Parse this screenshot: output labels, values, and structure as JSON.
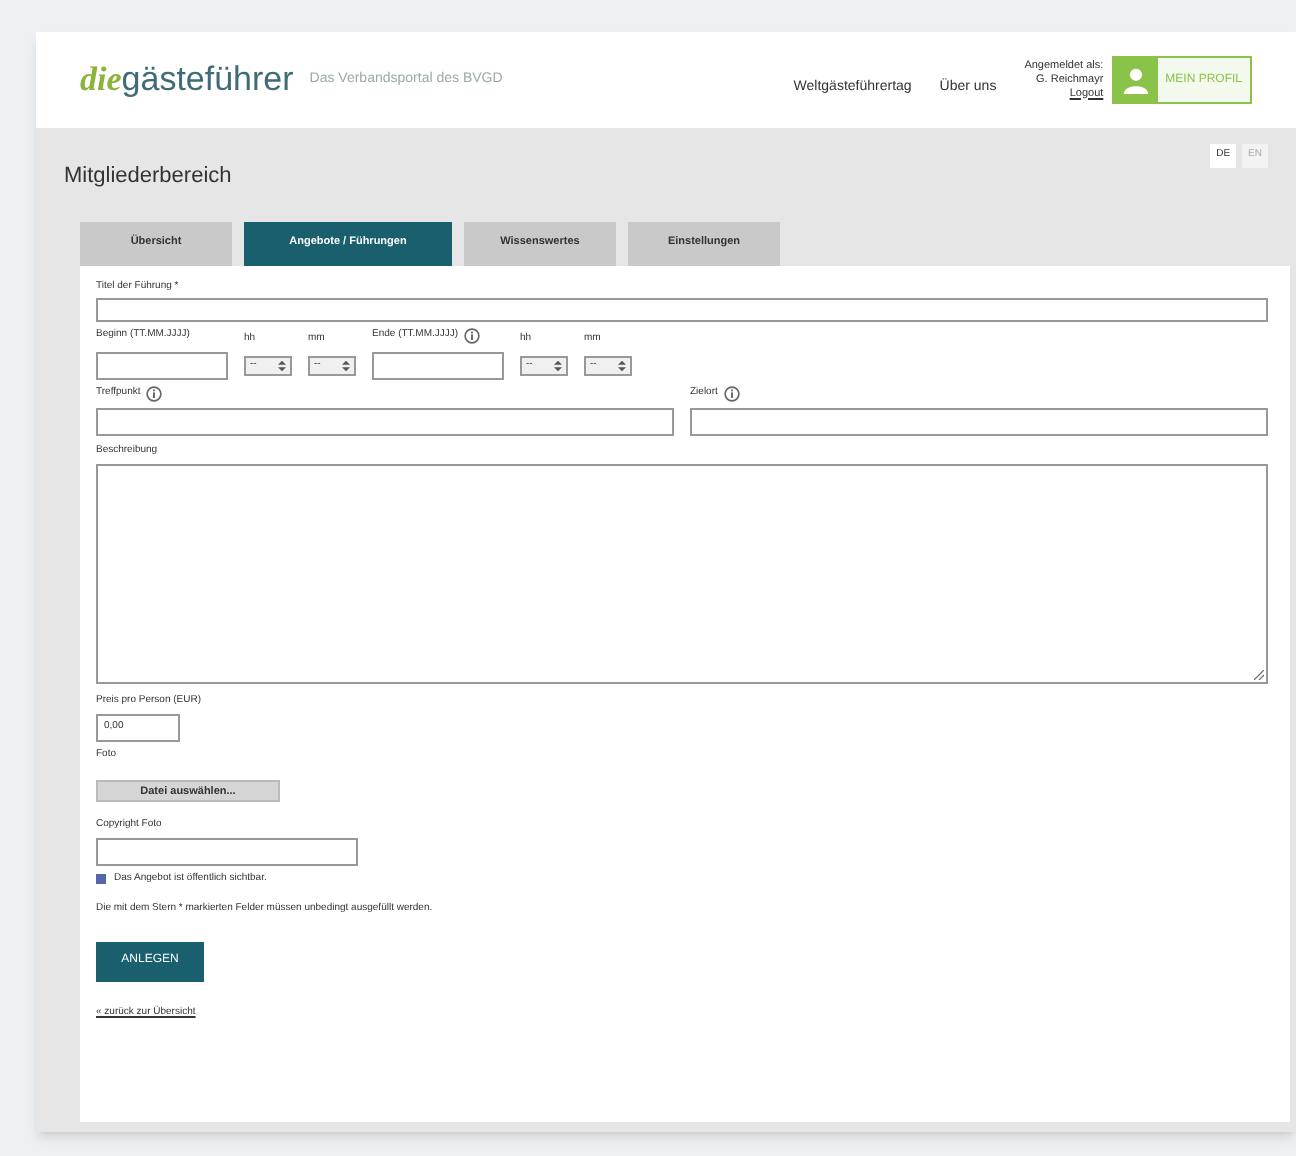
{
  "header": {
    "logo_prefix": "die",
    "logo_name": "gästeführer",
    "tagline": "Das Verbandsportal des BVGD",
    "nav": [
      "Weltgästeführertag",
      "Über uns"
    ],
    "login": [
      "Angemeldet als:",
      "G. Reichmayr",
      "Logout"
    ],
    "profile_button": "MEIN PROFIL",
    "languages": [
      {
        "label": "DE",
        "selected": true
      },
      {
        "label": "EN",
        "selected": false
      }
    ]
  },
  "page_title": "Mitgliederbereich",
  "tabs": [
    {
      "label": "Übersicht",
      "selected": false
    },
    {
      "label": "Angebote / Führungen",
      "selected": true
    },
    {
      "label": "Wissenswertes",
      "selected": false
    },
    {
      "label": "Einstellungen",
      "selected": false
    }
  ],
  "form": {
    "title_label": "Titel der Führung *",
    "time_fields": [
      {
        "label": "Beginn (TT.MM.JJJJ)",
        "kind": "date",
        "info": false
      },
      {
        "label": "hh",
        "kind": "select",
        "value": "--"
      },
      {
        "label": "mm",
        "kind": "select",
        "value": "--"
      },
      {
        "label": "Ende (TT.MM.JJJJ)",
        "kind": "date",
        "info": true
      },
      {
        "label": "hh",
        "kind": "select",
        "value": "--"
      },
      {
        "label": "mm",
        "kind": "select",
        "value": "--"
      }
    ],
    "place_fields": [
      {
        "label": "Treffpunkt"
      },
      {
        "label": "Zielort"
      }
    ],
    "description_label": "Beschreibung",
    "price_label": "Preis pro Person (EUR)",
    "price_value": "0,00",
    "photo_label": "Foto",
    "file_button": "Datei auswählen...",
    "copyright_label": "Copyright Foto",
    "public": {
      "label": "Das Angebot ist öffentlich sichtbar.",
      "checked": true
    },
    "note": "Die mit dem Stern * markierten Felder müssen unbedingt ausgefüllt werden.",
    "submit": "ANLEGEN",
    "back_link": "« zurück zur Übersicht"
  }
}
